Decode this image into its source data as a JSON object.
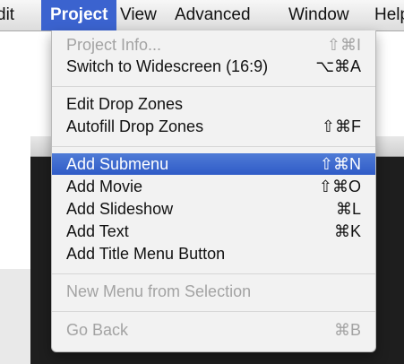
{
  "menubar": {
    "items": [
      "dit",
      "Project",
      "View",
      "Advanced",
      "Window",
      "Help"
    ]
  },
  "menu": {
    "items": [
      {
        "label": "Project Info...",
        "shortcut": "⇧⌘I",
        "enabled": false
      },
      {
        "label": "Switch to Widescreen (16:9)",
        "shortcut": "⌥⌘A",
        "enabled": true
      },
      {
        "label": "Edit Drop Zones",
        "shortcut": "",
        "enabled": true
      },
      {
        "label": "Autofill Drop Zones",
        "shortcut": "⇧⌘F",
        "enabled": true
      },
      {
        "label": "Add Submenu",
        "shortcut": "⇧⌘N",
        "enabled": true,
        "highlighted": true
      },
      {
        "label": "Add Movie",
        "shortcut": "⇧⌘O",
        "enabled": true
      },
      {
        "label": "Add Slideshow",
        "shortcut": "⌘L",
        "enabled": true
      },
      {
        "label": "Add Text",
        "shortcut": "⌘K",
        "enabled": true
      },
      {
        "label": "Add Title Menu Button",
        "shortcut": "",
        "enabled": true
      },
      {
        "label": "New Menu from Selection",
        "shortcut": "",
        "enabled": false
      },
      {
        "label": "Go Back",
        "shortcut": "⌘B",
        "enabled": false
      }
    ]
  },
  "colors": {
    "highlight": "#3b63cf",
    "disabled_text": "#a3a3a3"
  }
}
